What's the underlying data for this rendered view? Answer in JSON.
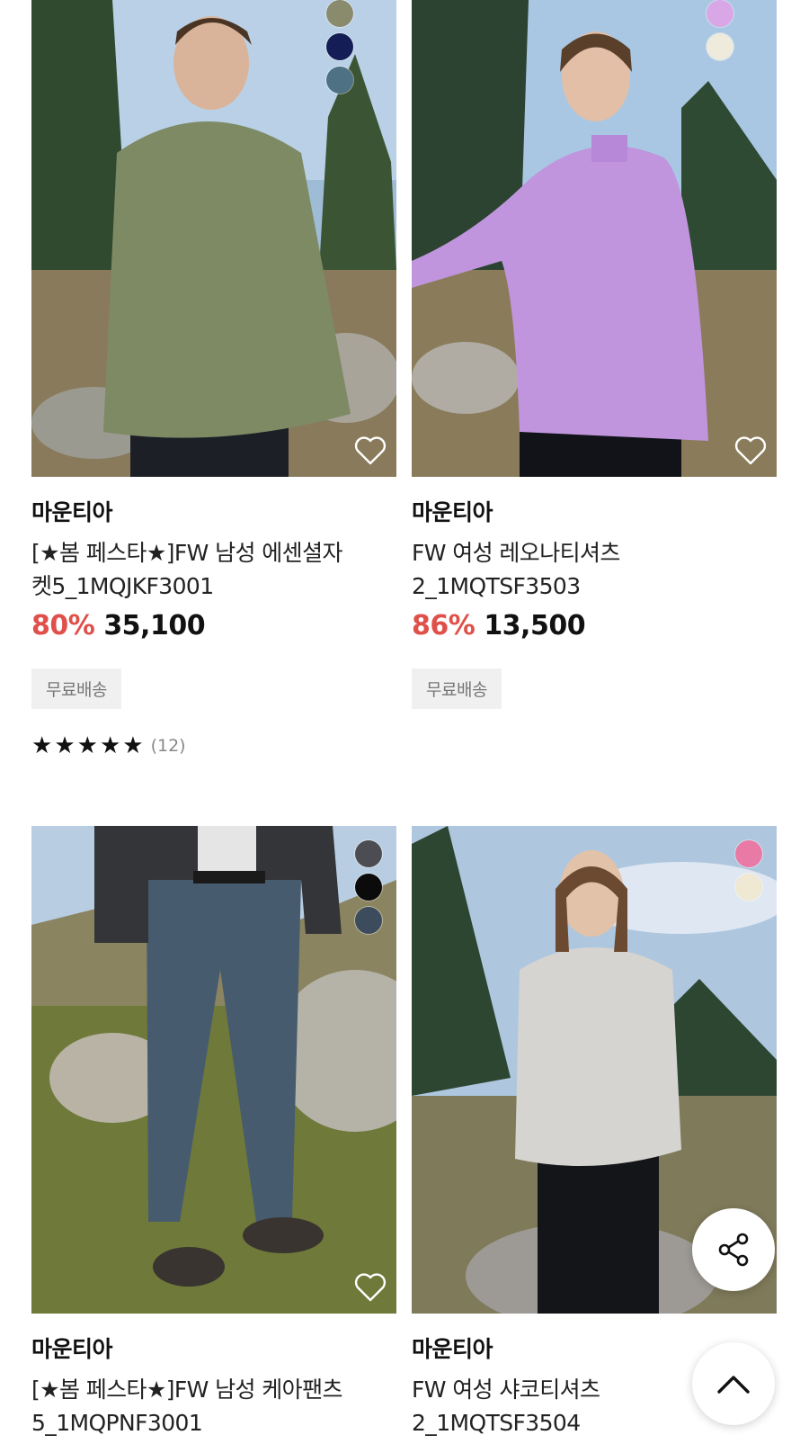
{
  "products": [
    {
      "brand": "마운티아",
      "name_line1": "[★봄 페스타★]FW 남성 에센셜자",
      "name_line2": "켓5_1MQJKF3001",
      "discount": "80%",
      "price": "35,100",
      "shipping_badge": "무료배송",
      "rating_stars": 5,
      "review_count": "(12)",
      "swatch_colors": [
        "#8a8a6c",
        "#141d55",
        "#4f7184"
      ],
      "photo_subject": "man in olive hooded jacket on mountain"
    },
    {
      "brand": "마운티아",
      "name_line1": "FW 여성 레오나티셔츠",
      "name_line2": "2_1MQTSF3503",
      "discount": "86%",
      "price": "13,500",
      "shipping_badge": "무료배송",
      "swatch_colors": [
        "#d9a7e6",
        "#eeebdd"
      ],
      "photo_subject": "woman in lavender half-zip top"
    },
    {
      "brand": "마운티아",
      "name_line1": "[★봄 페스타★]FW 남성 케아팬츠",
      "name_line2": "5_1MQPNF3001",
      "swatch_colors": [
        "#4c4d52",
        "#0b0b0b",
        "#3c4c5c"
      ],
      "photo_subject": "man in slate blue hiking pants"
    },
    {
      "brand": "마운티아",
      "name_line1": "FW 여성 샤코티셔츠",
      "name_line2": "2_1MQTSF3504",
      "swatch_colors": [
        "#e97aa5",
        "#efe8d2"
      ],
      "photo_subject": "woman in light grey sweatshirt"
    }
  ],
  "fab": {
    "share": "share-icon",
    "top": "chevron-up-icon"
  }
}
